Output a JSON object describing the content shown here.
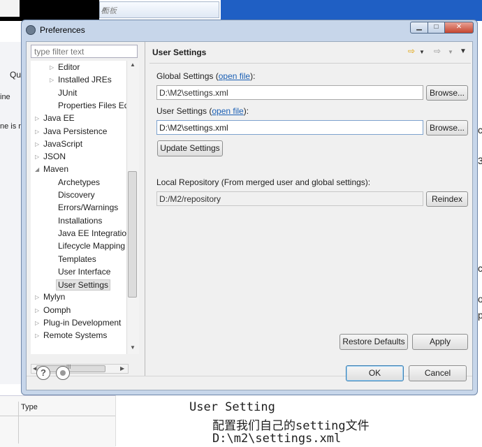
{
  "background": {
    "search_placeholder": "面板",
    "left_fragments": [
      "Qu",
      "ine",
      "ne is r"
    ],
    "right_fragments": [
      "c",
      "3",
      "c",
      "o",
      "p"
    ],
    "table_header": "Type",
    "note_lines": [
      "User Setting",
      "配置我们自己的setting文件",
      "D:\\m2\\settings.xml"
    ]
  },
  "window": {
    "title": "Preferences",
    "controls": {
      "minimize": "▁",
      "maximize": "□",
      "close": "✕"
    }
  },
  "left": {
    "filter_placeholder": "type filter text",
    "tree": [
      {
        "label": "Editor",
        "indent": 2,
        "expander": "collapsed"
      },
      {
        "label": "Installed JREs",
        "indent": 2,
        "expander": "collapsed"
      },
      {
        "label": "JUnit",
        "indent": 2,
        "expander": "none"
      },
      {
        "label": "Properties Files Ed",
        "indent": 2,
        "expander": "none"
      },
      {
        "label": "Java EE",
        "indent": 1,
        "expander": "collapsed"
      },
      {
        "label": "Java Persistence",
        "indent": 1,
        "expander": "collapsed"
      },
      {
        "label": "JavaScript",
        "indent": 1,
        "expander": "collapsed"
      },
      {
        "label": "JSON",
        "indent": 1,
        "expander": "collapsed"
      },
      {
        "label": "Maven",
        "indent": 1,
        "expander": "expanded"
      },
      {
        "label": "Archetypes",
        "indent": 2,
        "expander": "none"
      },
      {
        "label": "Discovery",
        "indent": 2,
        "expander": "none"
      },
      {
        "label": "Errors/Warnings",
        "indent": 2,
        "expander": "none"
      },
      {
        "label": "Installations",
        "indent": 2,
        "expander": "none"
      },
      {
        "label": "Java EE Integration",
        "indent": 2,
        "expander": "none"
      },
      {
        "label": "Lifecycle Mapping",
        "indent": 2,
        "expander": "none"
      },
      {
        "label": "Templates",
        "indent": 2,
        "expander": "none"
      },
      {
        "label": "User Interface",
        "indent": 2,
        "expander": "none"
      },
      {
        "label": "User Settings",
        "indent": 2,
        "expander": "none",
        "selected": true
      },
      {
        "label": "Mylyn",
        "indent": 1,
        "expander": "collapsed"
      },
      {
        "label": "Oomph",
        "indent": 1,
        "expander": "collapsed"
      },
      {
        "label": "Plug-in Development",
        "indent": 1,
        "expander": "collapsed"
      },
      {
        "label": "Remote Systems",
        "indent": 1,
        "expander": "collapsed"
      }
    ],
    "hscroll_grip": "III"
  },
  "right": {
    "page_title": "User Settings",
    "global_label": "Global Settings (",
    "global_link": "open file",
    "global_suffix": "):",
    "global_value": "D:\\M2\\settings.xml",
    "browse_label": "Browse...",
    "user_label": "User Settings (",
    "user_link": "open file",
    "user_suffix": "):",
    "user_value": "D:\\M2\\settings.xml",
    "update_label": "Update Settings",
    "local_repo_label": "Local Repository (From merged user and global settings):",
    "local_repo_value": "D:/M2/repository",
    "reindex_label": "Reindex",
    "restore_label": "Restore Defaults",
    "apply_label": "Apply"
  },
  "footer": {
    "help_glyph": "?",
    "ok_label": "OK",
    "cancel_label": "Cancel"
  }
}
